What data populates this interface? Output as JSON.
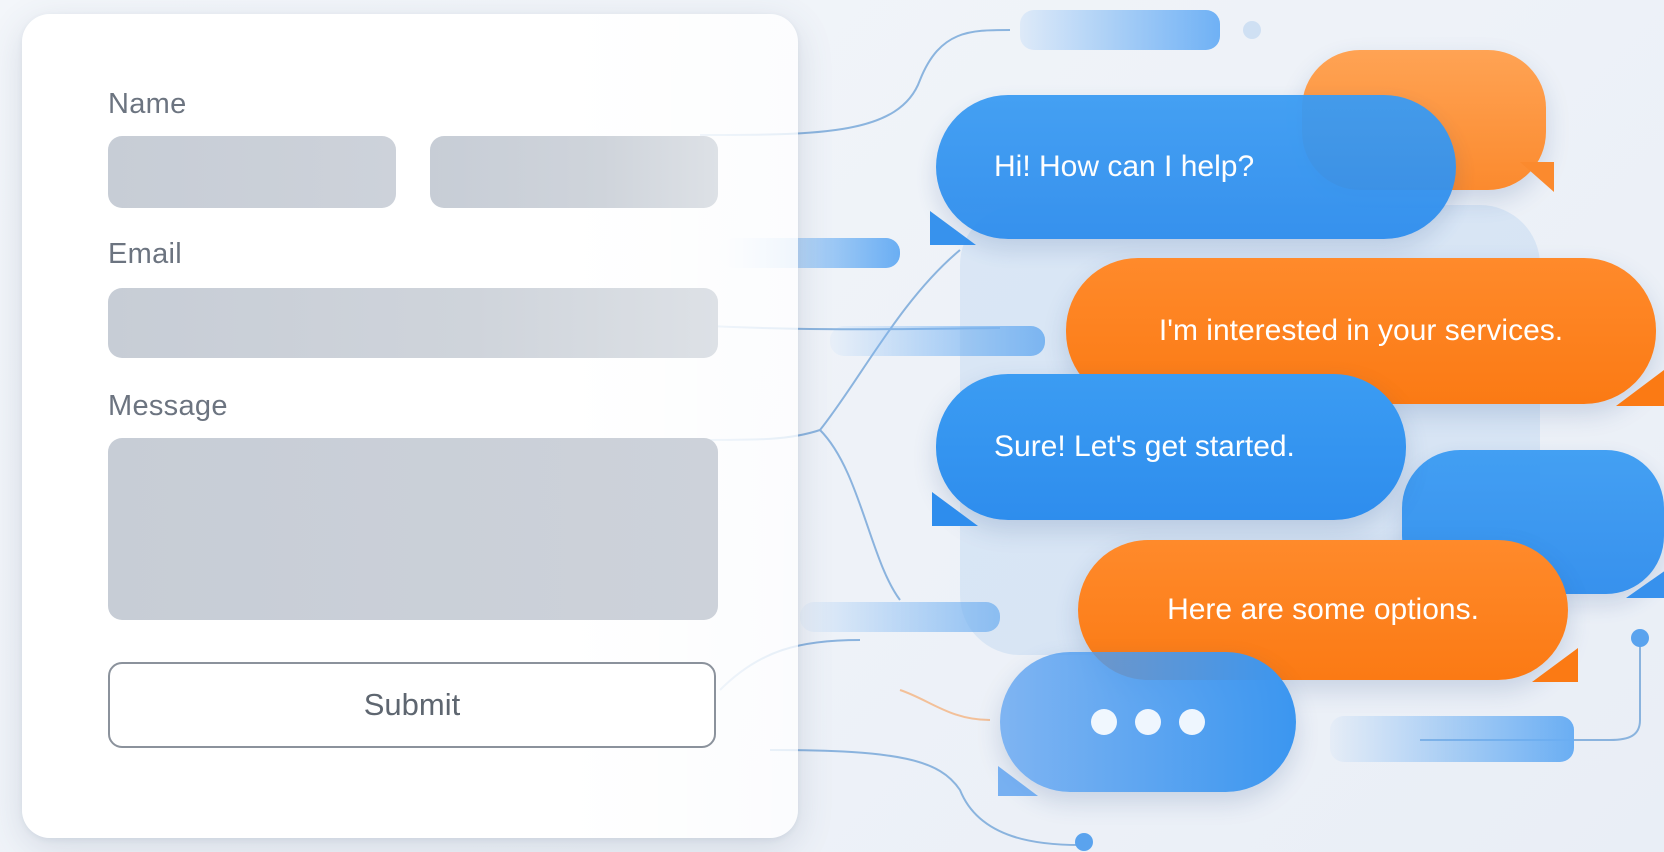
{
  "form": {
    "name_label": "Name",
    "email_label": "Email",
    "message_label": "Message",
    "submit_label": "Submit"
  },
  "chat": {
    "messages": [
      {
        "sender": "bot",
        "text": "Hi! How can I help?"
      },
      {
        "sender": "user",
        "text": "I'm interested in your services."
      },
      {
        "sender": "bot",
        "text": "Sure! Let's get started."
      },
      {
        "sender": "user",
        "text": "Here are some options."
      }
    ]
  },
  "colors": {
    "bot_bubble": "#2e8ded",
    "user_bubble": "#fb7a14",
    "field_fill": "#c7cdd6",
    "connector": "#6a9fd6"
  },
  "icons": {
    "typing_indicator": "three-dots-icon"
  }
}
